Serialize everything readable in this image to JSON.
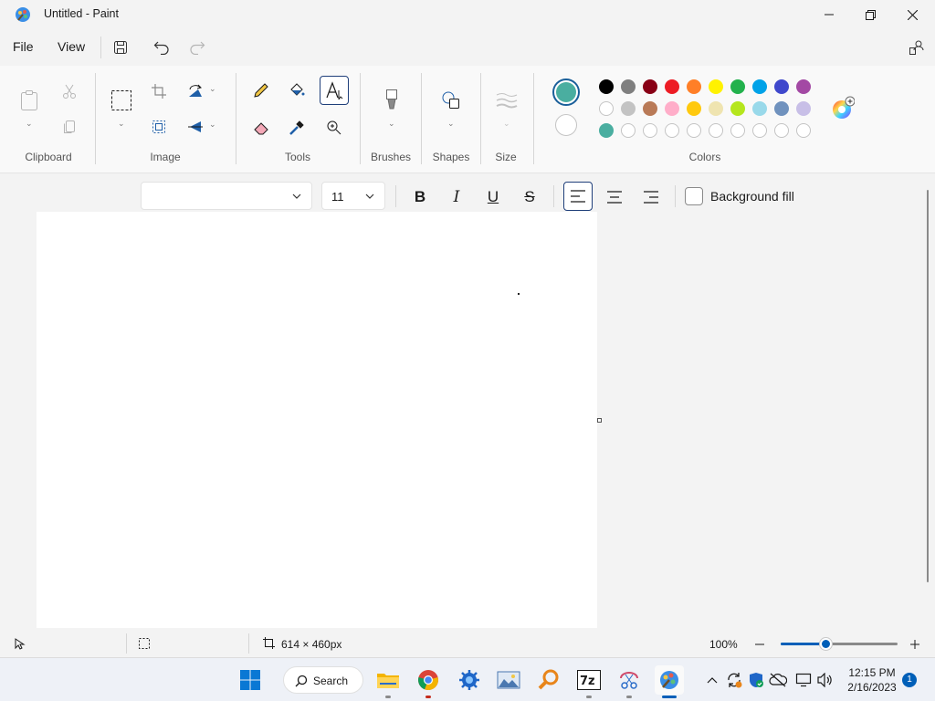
{
  "window": {
    "title": "Untitled - Paint"
  },
  "menu": {
    "file": "File",
    "view": "View"
  },
  "ribbon": {
    "groups": {
      "clipboard": "Clipboard",
      "image": "Image",
      "tools": "Tools",
      "brushes": "Brushes",
      "shapes": "Shapes",
      "size": "Size",
      "colors": "Colors"
    },
    "colors": {
      "primary": "#4aaea0",
      "secondary": "#ffffff",
      "palette_row1": [
        "#000000",
        "#7f7f7f",
        "#880015",
        "#ed1c24",
        "#ff7f27",
        "#fff200",
        "#22b14c",
        "#00a2e8",
        "#3f48cc",
        "#a349a4"
      ],
      "palette_row2": [
        "#ffffff",
        "#c3c3c3",
        "#b97a57",
        "#ffaec9",
        "#ffc90e",
        "#efe4b0",
        "#b5e61d",
        "#99d9ea",
        "#7092be",
        "#c8bfe7"
      ],
      "palette_row3": [
        "#4aaea0",
        "",
        "",
        "",
        "",
        "",
        "",
        "",
        "",
        ""
      ]
    }
  },
  "text_toolbar": {
    "font_family": "",
    "font_size": "11",
    "background_fill": "Background fill",
    "bold": "B",
    "italic": "I",
    "underline": "U",
    "strikethrough": "S"
  },
  "status": {
    "canvas_size": "614 × 460px",
    "zoom": "100%",
    "zoom_fraction": 0.38
  },
  "taskbar": {
    "search": "Search",
    "time": "12:15 PM",
    "date": "2/16/2023",
    "notifications": "1"
  }
}
